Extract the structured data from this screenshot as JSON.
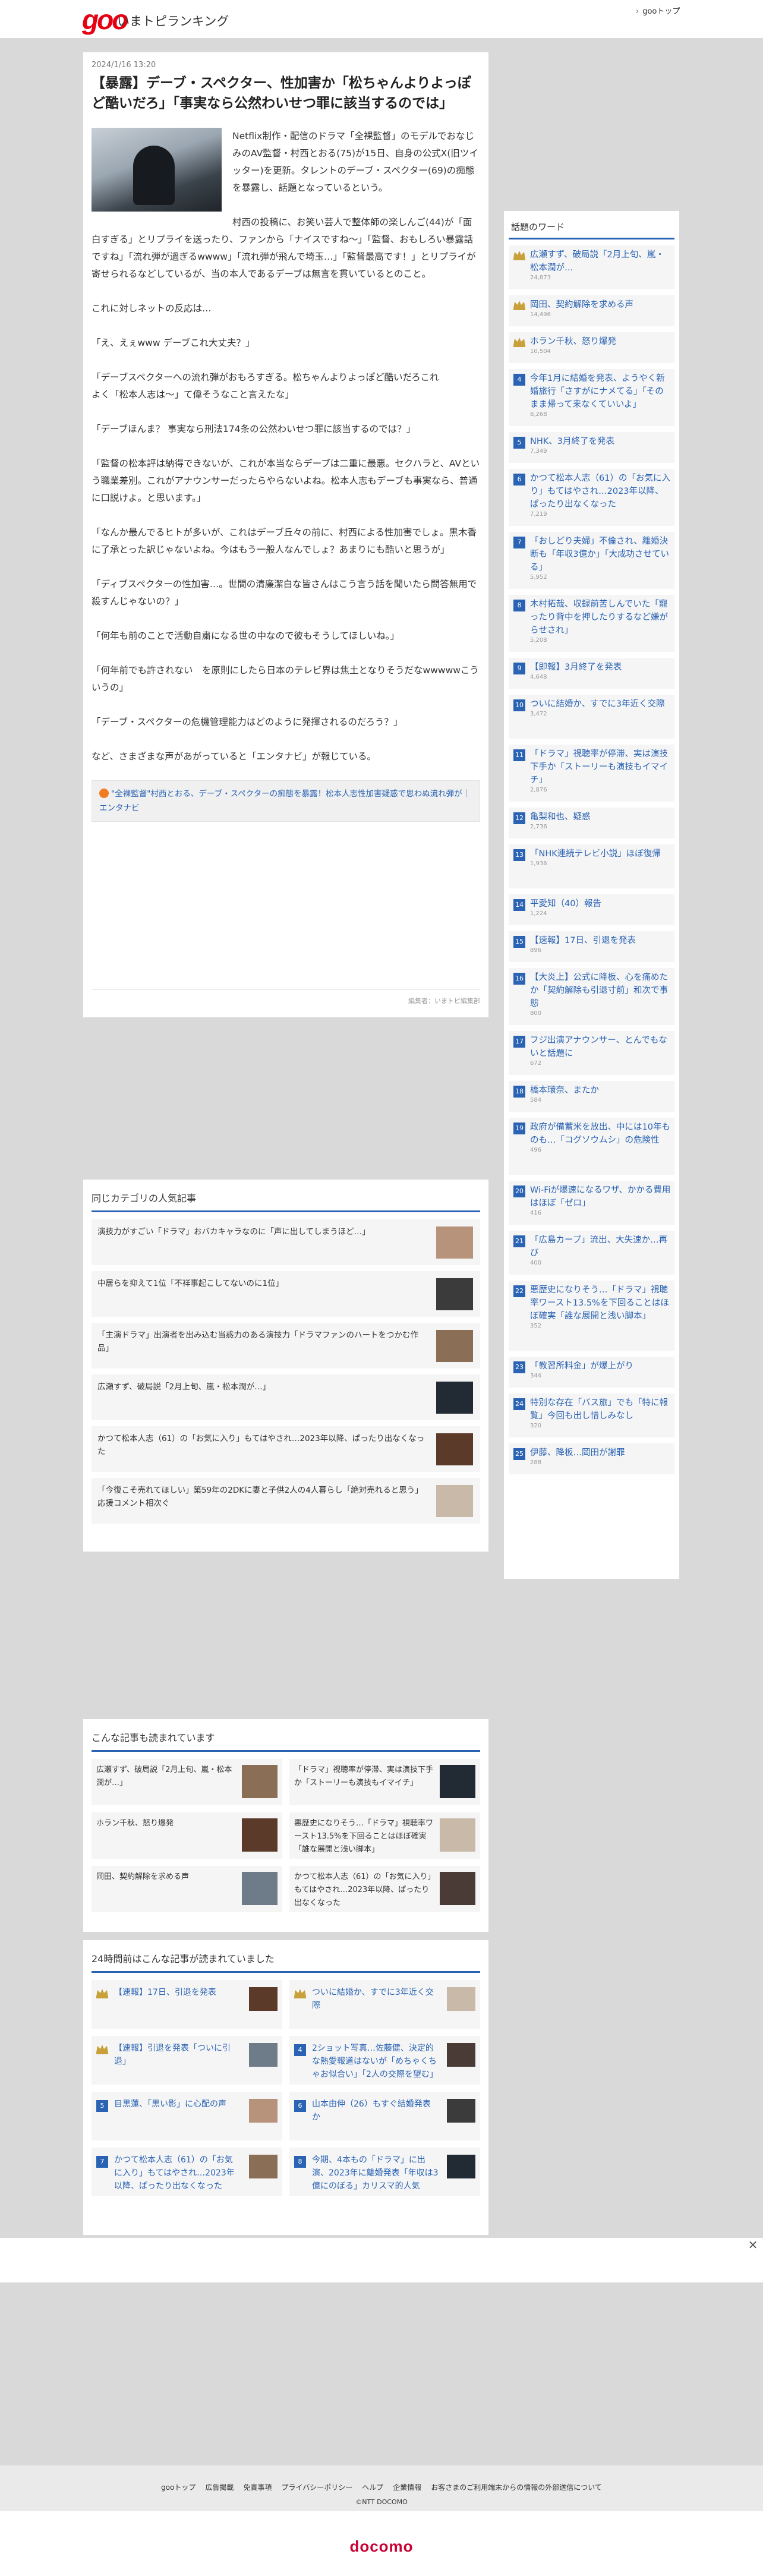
{
  "header": {
    "logo": "goo",
    "site_title": "いまトピランキング",
    "goo_top": "gooトップ"
  },
  "article": {
    "date": "2024/1/16 13:20",
    "title": "【暴露】デーブ・スペクター、性加害か「松ちゃんよりよっぽど酷いだろ」「事実なら公然わいせつ罪に該当するのでは」",
    "paragraphs": [
      "Netflix制作・配信のドラマ「全裸監督」のモデルでおなじみのAV監督・村西とおる(75)が15日、自身の公式X(旧ツイッター)を更新。タレントのデーブ・スペクター(69)の痴態を暴露し、話題となっているという。",
      "村西の投稿に、お笑い芸人で整体師の楽しんご(44)が「面白すぎる」とリプライを送ったり、ファンから「ナイスですね～」「監督、おもしろい暴露話ですね」「流れ弾が過ぎるwwww」「流れ弾が飛んで埼玉…」「監督最高です！」とリプライが寄せられるなどしているが、当の本人であるデーブは無言を貫いているとのこと。",
      "これに対しネットの反応は…",
      "「え、えぇwww デーブこれ大丈夫？」",
      "「デーブスペクターへの流れ弾がおもろすぎる。松ちゃんよりよっぽど酷いだろこれ\nよく「松本人志は～」て偉そうなこと言えたな」",
      "「デーブほんま？ 事実なら刑法174条の公然わいせつ罪に該当するのでは？」",
      "「監督の松本評は納得できないが、これが本当ならデーブは二重に最悪。セクハラと、AVという職業差別。これがアナウンサーだったらやらないよね。松本人志もデーブも事実なら、普通に口説けよ。と思います。」",
      "「なんか最んでるヒトが多いが、これはデーブ丘々の前に、村西による性加害でしょ。黒木香に了承とった訳じゃないよね。今はもう一般人なんでしょ？あまりにも酷いと思うが」",
      "「ディブスペクターの性加害…。世間の清廉潔白な皆さんはこう言う話を聞いたら問答無用で殺すんじゃないの？」",
      "「何年も前のことで活動自粛になる世の中なので彼もそうしてほしいね。」",
      "「何年前でも許されない　を原則にしたら日本のテレビ界は焦土となりそうだなwwwwwこういうの」",
      "「デーブ・スペクターの危機管理能力はどのように発揮されるのだろう？」",
      "など、さまざまな声があがっていると「エンタナビ」が報じている。"
    ],
    "related_link": "\"全裸監督\"村西とおる、デーブ・スペクターの痴態を暴露！松本人志性加害疑惑で思わぬ流れ弾が｜エンタナビ",
    "source": "編集者：いまトピ編集部"
  },
  "sidebar": {
    "title": "話題のワード",
    "items": [
      {
        "rank": "1",
        "label": "広瀬すず、破局説「2月上旬、嵐・松本潤が…",
        "count": "24,873"
      },
      {
        "rank": "2",
        "label": "岡田、契約解除を求める声",
        "count": "14,496"
      },
      {
        "rank": "3",
        "label": "ホラン千秋、怒り爆発",
        "count": "10,504"
      },
      {
        "rank": "4",
        "label": "今年1月に結婚を発表、ようやく新婚旅行「さすがにナメてる」「そのまま帰って来なくていいよ」",
        "count": "8,268"
      },
      {
        "rank": "5",
        "label": "NHK、3月終了を発表",
        "count": "7,349"
      },
      {
        "rank": "6",
        "label": "かつて松本人志（61）の「お気に入り」もてはやされ…2023年以降、ぱったり出なくなった",
        "count": "7,219"
      },
      {
        "rank": "7",
        "label": "「おしどり夫婦」不倫され、離婚決断も「年収3億か」「大成功させている」",
        "count": "5,952"
      },
      {
        "rank": "8",
        "label": "木村拓哉、収録前苦しんでいた「寵ったり背中を押したりするなど嫌がらせされ」",
        "count": "5,208"
      },
      {
        "rank": "9",
        "label": "【即報】3月終了を発表",
        "count": "4,648"
      },
      {
        "rank": "10",
        "label": "ついに結婚か、すでに3年近く交際",
        "count": "3,472"
      },
      {
        "rank": "11",
        "label": "「ドラマ」視聴率が停滞、実は演技下手か「ストーリーも演技もイマイチ」",
        "count": "2,876"
      },
      {
        "rank": "12",
        "label": "亀梨和也、疑惑",
        "count": "2,736"
      },
      {
        "rank": "13",
        "label": "「NHK連続テレビ小説」ほぼ復帰",
        "count": "1,936"
      },
      {
        "rank": "14",
        "label": "平愛知（40）報告",
        "count": "1,224"
      },
      {
        "rank": "15",
        "label": "【速報】17日、引退を発表",
        "count": "896"
      },
      {
        "rank": "16",
        "label": "【大炎上】公式に降板、心を痛めたか「契約解除も引退寸前」和次で事態",
        "count": "800"
      },
      {
        "rank": "17",
        "label": "フジ出演アナウンサー、とんでもないと話題に",
        "count": "672"
      },
      {
        "rank": "18",
        "label": "橋本環奈、またか",
        "count": "584"
      },
      {
        "rank": "19",
        "label": "政府が備蓄米を放出、中には10年ものも…「コグソウムシ」の危険性",
        "count": "496"
      },
      {
        "rank": "20",
        "label": "Wi-Fiが爆速になるワザ、かかる費用はほぼ「ゼロ」",
        "count": "416"
      },
      {
        "rank": "21",
        "label": "「広島カープ」流出、大失速か…再び",
        "count": "400"
      },
      {
        "rank": "22",
        "label": "悪歴史になりそう…「ドラマ」視聴率ワースト13.5%を下回ることはほぼ確実「誰な展開と浅い脚本」",
        "count": "352"
      },
      {
        "rank": "23",
        "label": "「教習所料金」が爆上がり",
        "count": "344"
      },
      {
        "rank": "24",
        "label": "特別な存在「バス旅」でも「特に報覧」今回も出し惜しみなし",
        "count": "320"
      },
      {
        "rank": "25",
        "label": "伊藤、降板…岡田が謝罪",
        "count": "288"
      }
    ]
  },
  "category": {
    "title": "同じカテゴリの人気記事",
    "items": [
      "演技力がすごい「ドラマ」おバカキャラなのに「声に出してしまうほど…」",
      "中居らを抑えて1位「不祥事起こしてないのに1位」",
      "「主演ドラマ」出演者を出み込む当惑力のある演技力「ドラマファンのハートをつかむ作品」",
      "広瀬すず、破局説「2月上旬、嵐・松本潤が…」",
      "かつて松本人志（61）の「お気に入り」もてはやされ…2023年以降、ぱったり出なくなった",
      "「今復こそ売れてほしい」築59年の2DKに妻と子供2人の4人暮らし「絶対売れると思う」応援コメント相次ぐ"
    ]
  },
  "also_read": {
    "title": "こんな記事も読まれています",
    "items": [
      "広瀬すず、破局説「2月上旬、嵐・松本潤が…」",
      "「ドラマ」視聴率が停滞、実は演技下手か「ストーリーも演技もイマイチ」",
      "ホラン千秋、怒り爆発",
      "悪歴史になりそう…「ドラマ」視聴率ワースト13.5%を下回ることはほぼ確実「誰な展開と浅い脚本」",
      "岡田、契約解除を求める声",
      "かつて松本人志（61）の「お気に入り」もてはやされ…2023年以降、ぱったり出なくなった"
    ]
  },
  "h24": {
    "title": "24時間前はこんな記事が読まれていました",
    "items": [
      {
        "rank": "1",
        "label": "【速報】17日、引退を発表"
      },
      {
        "rank": "2",
        "label": "ついに結婚か、すでに3年近く交際"
      },
      {
        "rank": "3",
        "label": "【速報】引退を発表「ついに引退」"
      },
      {
        "rank": "4",
        "label": "2ショット写真…佐藤健、決定的な熱愛報道はないが「めちゃくちゃお似合い」「2人の交際を望む」"
      },
      {
        "rank": "5",
        "label": "目黒蓮、「黒い影」に心配の声"
      },
      {
        "rank": "6",
        "label": "山本由伸（26）もすぐ結婚発表か"
      },
      {
        "rank": "7",
        "label": "かつて松本人志（61）の「お気に入り」もてはやされ…2023年以降、ぱったり出なくなった"
      },
      {
        "rank": "8",
        "label": "今期、4本もの「ドラマ」に出演、2023年に離婚発表「年収は3億にのぼる」カリスマ的人気"
      }
    ]
  },
  "footer": {
    "links": [
      "gooトップ",
      "広告掲載",
      "免責事項",
      "プライバシーポリシー",
      "ヘルプ",
      "企業情報",
      "お客さまのご利用端末からの情報の外部送信について"
    ],
    "copyright": "©NTT DOCOMO",
    "brand": "docomo"
  },
  "colors": {
    "accent": "#2a63b3",
    "logo_red": "#e60012",
    "docomo_red": "#cc0033"
  },
  "icons": {
    "crown": "crown-icon",
    "close": "close-icon"
  }
}
